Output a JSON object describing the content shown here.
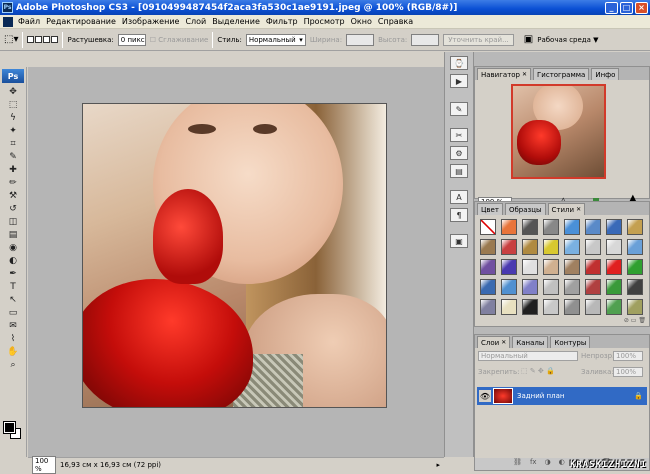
{
  "window": {
    "app_icon": "Ps",
    "title": "Adobe Photoshop CS3 - [0910499487454f2aca3fa530c1ae9191.jpeg @ 100% (RGB/8#)]",
    "buttons": [
      "_",
      "□",
      "×"
    ]
  },
  "menu": [
    "Файл",
    "Редактирование",
    "Изображение",
    "Слой",
    "Выделение",
    "Фильтр",
    "Просмотр",
    "Окно",
    "Справка"
  ],
  "options": {
    "feather_label": "Растушевка:",
    "feather_value": "0 пикс",
    "antialias_label": "Сглаживание",
    "style_label": "Стиль:",
    "style_value": "Нормальный",
    "width_label": "Ширина:",
    "height_label": "Высота:",
    "refine_button": "Уточнить край...",
    "workspace_label": "Рабочая среда ▼"
  },
  "toolbox": {
    "logo": "Ps",
    "tools": [
      "move-icon",
      "marquee-icon",
      "lasso-icon",
      "magic-wand-icon",
      "crop-icon",
      "slice-icon",
      "healing-icon",
      "brush-icon",
      "stamp-icon",
      "history-brush-icon",
      "eraser-icon",
      "gradient-icon",
      "blur-icon",
      "dodge-icon",
      "pen-icon",
      "type-icon",
      "path-select-icon",
      "shape-icon",
      "notes-icon",
      "eyedropper-icon",
      "hand-icon",
      "zoom-icon"
    ],
    "tool_glyphs": [
      "✥",
      "⬚",
      "ϟ",
      "✦",
      "⌗",
      "✎",
      "✚",
      "✏",
      "⚒",
      "↺",
      "◫",
      "▤",
      "◉",
      "◐",
      "✒",
      "T",
      "↖",
      "▭",
      "✉",
      "⌇",
      "✋",
      "⌕"
    ]
  },
  "status": {
    "zoom": "100 %",
    "doc_info": "16,93 см x 16,93 см (72 ppi)"
  },
  "navigator": {
    "tabs": [
      "Навигатор",
      "Гистограмма",
      "Инфо"
    ],
    "zoom": "100 %"
  },
  "styles_panel": {
    "tabs": [
      "Цвет",
      "Образцы",
      "Стили"
    ],
    "colors": [
      "#ffffff",
      "#e8743a",
      "#555555",
      "#888888",
      "#4a90d8",
      "#5a8ac8",
      "#3a6ab8",
      "#c4a050",
      "#9a7a50",
      "#c84040",
      "#b08a40",
      "#d8c830",
      "#7ab0e0",
      "#c8c8c8",
      "#d8d8d8",
      "#6aa0d8",
      "#7050a0",
      "#4a3ab0",
      "#e0e0e0",
      "#d0b090",
      "#a08060",
      "#c03030",
      "#e02020",
      "#30a030",
      "#3a6ab0",
      "#5090d0",
      "#8080c8",
      "#c0c0c0",
      "#a0a0a0",
      "#b04040",
      "#3a9a3a",
      "#404040",
      "#8080a0",
      "#e8e0c0",
      "#202020",
      "#c8c8c8",
      "#909090",
      "#b8b8b8",
      "#50a050",
      "#a0a060"
    ]
  },
  "layers": {
    "tabs": [
      "Слои",
      "Каналы",
      "Контуры"
    ],
    "blend_mode": "Нормальный",
    "opacity_label": "Непрозр.:",
    "opacity_value": "100%",
    "lock_label": "Закрепить:",
    "fill_label": "Заливка:",
    "fill_value": "100%",
    "layer_name": "Задний план",
    "bottom_glyphs": [
      "⛓",
      "fx",
      "◑",
      "◐",
      "▭",
      "▣",
      "🗑"
    ]
  },
  "watermark": "KRASKIZHIZNI"
}
